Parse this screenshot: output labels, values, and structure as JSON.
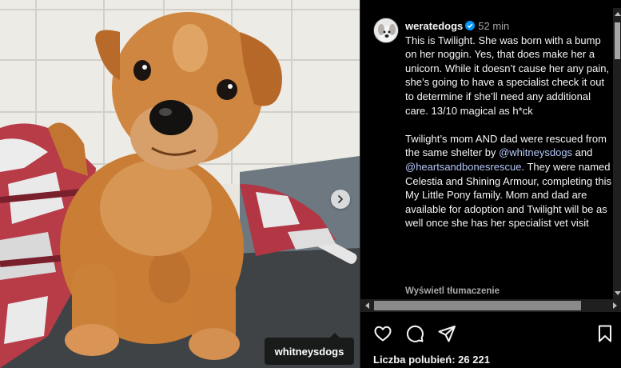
{
  "photo": {
    "tag_username": "whitneysdogs",
    "next_icon": "chevron-right-icon"
  },
  "post": {
    "username": "weratedogs",
    "time": "52 min",
    "caption_paragraph1": "This is Twilight. She was born with a bump on her noggin. Yes, that does make her a unicorn. While it doesn’t cause her any pain, she’s going to have a specialist check it out to determine if she’ll need any additional care. 13/10 magical as h*ck",
    "caption_p2_before": "Twilight’s mom AND dad were rescued from the same shelter by",
    "mention1": "@whitneysdogs",
    "caption_p2_and": "and",
    "mention2": "@heartsandbonesrescue",
    "caption_p2_after": ". They were named Celestia and Shining Armour, completing this My Little Pony family. Mom and dad are available for adoption and Twilight will be as well once she has her specialist vet visit",
    "translate_label": "Wyświetl tłumaczenie",
    "likes_label": "Liczba polubień: 26 221"
  },
  "icons": {
    "like": "heart-icon",
    "comment": "comment-icon",
    "share": "send-icon",
    "save": "bookmark-icon",
    "verified": "verified-badge-icon"
  },
  "colors": {
    "background": "#000000",
    "verified": "#0095f6",
    "secondary_text": "#a8a8a8"
  }
}
